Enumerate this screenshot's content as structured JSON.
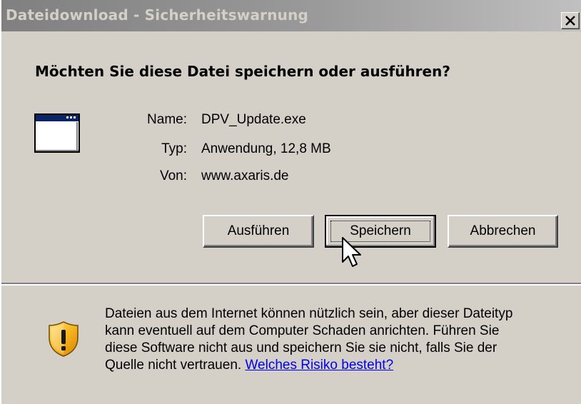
{
  "window": {
    "title": "Dateidownload - Sicherheitswarnung",
    "close_glyph": "✕"
  },
  "dialog": {
    "question": "Möchten Sie diese Datei speichern oder ausführen?",
    "file_icon": "application-window-icon",
    "fields": [
      {
        "label": "Name:",
        "value": "DPV_Update.exe"
      },
      {
        "label": "Typ:",
        "value": "Anwendung, 12,8 MB"
      },
      {
        "label": "Von:",
        "value": "www.axaris.de"
      }
    ]
  },
  "buttons": {
    "run": "Ausführen",
    "save": "Speichern",
    "cancel": "Abbrechen"
  },
  "warning": {
    "icon": "warning-shield-icon",
    "lines": [
      "Dateien aus dem Internet können nützlich sein, aber dieser Dateityp",
      "kann eventuell auf dem Computer Schaden anrichten. Führen Sie",
      "diese Software nicht aus und speichern Sie sie nicht, falls Sie der",
      "Quelle nicht vertrauen."
    ],
    "link": "Welches Risiko besteht?"
  },
  "colors": {
    "dialog_bg": "#d4d0c8",
    "titlebar_inactive": "#808080",
    "link": "#0000ee",
    "shield_orange": "#f0a010"
  }
}
